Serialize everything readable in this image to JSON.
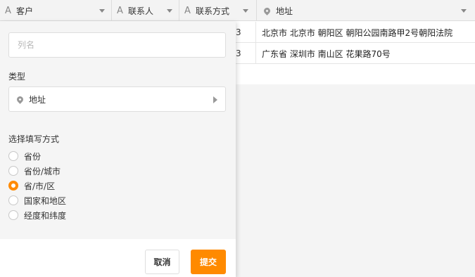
{
  "table": {
    "columns": [
      {
        "label": "客户",
        "icon": "text-type-icon"
      },
      {
        "label": "联系人",
        "icon": "text-type-icon"
      },
      {
        "label": "联系方式",
        "icon": "text-type-icon"
      },
      {
        "label": "地址",
        "icon": "location-pin-icon"
      }
    ],
    "rows": [
      {
        "phone_tail": "3",
        "address": "北京市 北京市 朝阳区 朝阳公园南路甲2号朝阳法院"
      },
      {
        "phone_tail": "3",
        "address": "广东省 深圳市 南山区 花果路70号"
      }
    ]
  },
  "panel": {
    "name_placeholder": "列名",
    "type_label": "类型",
    "type_value": "地址",
    "method_label": "选择填写方式",
    "options": [
      {
        "label": "省份",
        "selected": false
      },
      {
        "label": "省份/城市",
        "selected": false
      },
      {
        "label": "省/市/区",
        "selected": true
      },
      {
        "label": "国家和地区",
        "selected": false
      },
      {
        "label": "经度和纬度",
        "selected": false
      }
    ],
    "cancel_label": "取消",
    "submit_label": "提交"
  },
  "colors": {
    "accent": "#ff8a00",
    "header_bg": "#f3f3f3"
  }
}
